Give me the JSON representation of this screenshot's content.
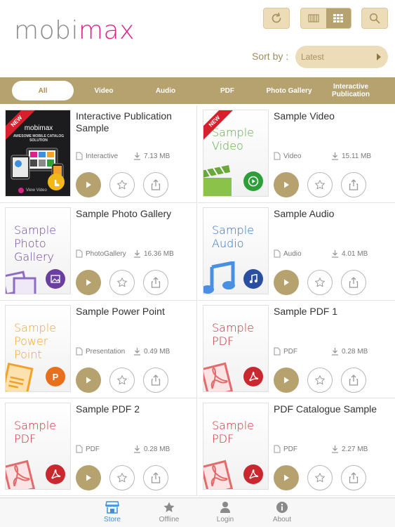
{
  "header": {
    "logo_part1": "mobi",
    "logo_part2": "max",
    "sort_label": "Sort by :",
    "sort_value": "Latest"
  },
  "categories": [
    {
      "label": "All",
      "active": true
    },
    {
      "label": "Video"
    },
    {
      "label": "Audio"
    },
    {
      "label": "PDF"
    },
    {
      "label": "Photo Gallery"
    },
    {
      "label": "Interactive Publication"
    }
  ],
  "items": [
    {
      "title": "Interactive Publication Sample",
      "type": "Interactive",
      "size": "7.13 MB",
      "is_new": true,
      "thumb": {
        "style": "dark",
        "top": "mobimax",
        "sub": "AWESOME MOBILE CATALOG SOLUTION",
        "foot": "View Video"
      }
    },
    {
      "title": "Sample Video",
      "type": "Video",
      "size": "15.11 MB",
      "is_new": true,
      "thumb": {
        "text": "Sample Video",
        "color": "#5aaa3c",
        "badge_color": "#2e9e3a",
        "icon": "video-icon"
      }
    },
    {
      "title": "Sample Photo Gallery",
      "type": "PhotoGallery",
      "size": "16.36 MB",
      "thumb": {
        "text": "Sample Photo Gallery",
        "color": "#6a3fa0",
        "badge_color": "#6a3fa0",
        "icon": "photo-icon"
      }
    },
    {
      "title": "Sample Audio",
      "type": "Audio",
      "size": "4.01 MB",
      "thumb": {
        "text": "Sample Audio",
        "color": "#2a6fc0",
        "badge_color": "#2a4fa0",
        "icon": "music-icon"
      }
    },
    {
      "title": "Sample Power Point",
      "type": "Presentation",
      "size": "0.49 MB",
      "thumb": {
        "text": "Sample Power Point",
        "color": "#f2a22a",
        "badge_color": "#e8701c",
        "icon": "powerpoint-icon"
      }
    },
    {
      "title": "Sample PDF 1",
      "type": "PDF",
      "size": "0.28 MB",
      "thumb": {
        "text": "Sample PDF",
        "color": "#c8282e",
        "badge_color": "#c8282e",
        "icon": "pdf-icon"
      }
    },
    {
      "title": "Sample PDF 2",
      "type": "PDF",
      "size": "0.28 MB",
      "thumb": {
        "text": "Sample PDF",
        "color": "#c8282e",
        "badge_color": "#c8282e",
        "icon": "pdf-icon"
      }
    },
    {
      "title": "PDF Catalogue Sample",
      "type": "PDF",
      "size": "2.27 MB",
      "thumb": {
        "text": "Sample PDF",
        "color": "#c8282e",
        "badge_color": "#c8282e",
        "icon": "pdf-icon"
      }
    }
  ],
  "new_badge": "NEW",
  "tabs": [
    {
      "label": "Store",
      "icon": "store-icon",
      "active": true
    },
    {
      "label": "Offline",
      "icon": "star-icon"
    },
    {
      "label": "Login",
      "icon": "user-icon"
    },
    {
      "label": "About",
      "icon": "info-icon"
    }
  ],
  "colors": {
    "accent": "#b6a26f",
    "accent_light": "#ecdcb8",
    "tab_active": "#3d8fe0",
    "logo_pink": "#e0208a"
  }
}
